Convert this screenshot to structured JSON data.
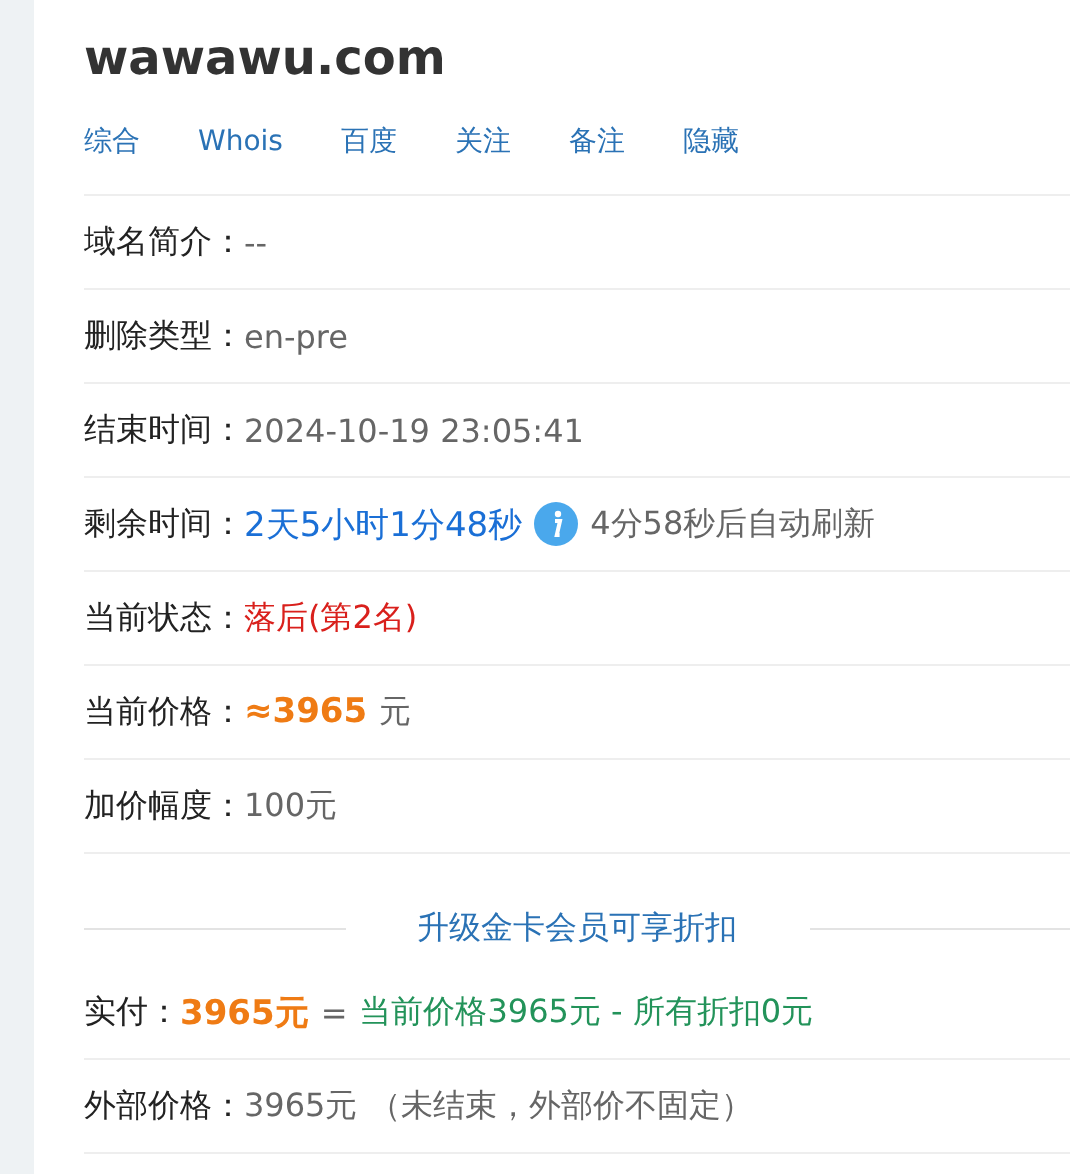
{
  "title": "wawawu.com",
  "tabs": [
    "综合",
    "Whois",
    "百度",
    "关注",
    "备注",
    "隐藏"
  ],
  "rows": [
    {
      "label": "域名简介：",
      "kind": "plain",
      "parts": [
        {
          "kind": "muted",
          "text": "--"
        }
      ]
    },
    {
      "label": "删除类型：",
      "kind": "plain",
      "parts": [
        {
          "kind": "muted",
          "text": "en-pre"
        }
      ]
    },
    {
      "label": "结束时间：",
      "kind": "plain",
      "parts": [
        {
          "kind": "muted",
          "text": "2024-10-19 23:05:41"
        }
      ]
    },
    {
      "label": "剩余时间：",
      "kind": "countdown",
      "parts": [
        {
          "kind": "countdown",
          "text": "2天5小时1分48秒"
        },
        {
          "kind": "muted",
          "text": "4分58秒后自动刷新"
        }
      ]
    },
    {
      "label": "当前状态：",
      "kind": "plain",
      "parts": [
        {
          "kind": "alert",
          "text": "落后(第2名)"
        }
      ]
    },
    {
      "label": "当前价格：",
      "kind": "plain",
      "parts": [
        {
          "kind": "price",
          "text": "≈3965"
        },
        {
          "kind": "muted",
          "text": "元"
        }
      ]
    },
    {
      "label": "加价幅度：",
      "kind": "plain",
      "parts": [
        {
          "kind": "muted",
          "text": "100元"
        }
      ]
    }
  ],
  "upgrade_link": "升级金卡会员可享折扣",
  "rows_after": [
    {
      "label": "实付：",
      "kind": "plain",
      "parts": [
        {
          "kind": "price",
          "text": "3965元"
        },
        {
          "kind": "muted",
          "text": "="
        },
        {
          "kind": "green",
          "text": "当前价格3965元 - 所有折扣0元"
        }
      ]
    },
    {
      "label": "外部价格：",
      "kind": "plain",
      "parts": [
        {
          "kind": "muted",
          "text": "3965元"
        },
        {
          "kind": "muted",
          "text": "（未结束，外部价不固定）"
        }
      ]
    }
  ]
}
